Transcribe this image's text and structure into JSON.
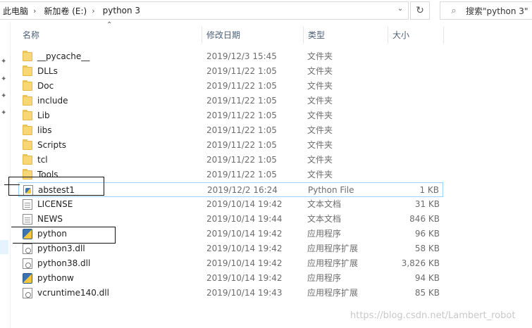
{
  "address": {
    "crumbs": [
      "此电脑",
      "新加卷 (E:)",
      "python 3"
    ],
    "separator": "›",
    "dropdown_glyph": "⌄",
    "refresh_glyph": "↻"
  },
  "search": {
    "placeholder": "搜索\"python 3\"",
    "icon_glyph": "⌕"
  },
  "columns": {
    "name": "名称",
    "date": "修改日期",
    "type": "类型",
    "size": "大小",
    "sort_glyph": "⌃"
  },
  "left_pane": {
    "pin_glyph": "✦"
  },
  "files": [
    {
      "name": "__pycache__",
      "date": "2019/12/3 15:45",
      "type": "文件夹",
      "size": "",
      "icon": "folder-icon"
    },
    {
      "name": "DLLs",
      "date": "2019/11/22 1:05",
      "type": "文件夹",
      "size": "",
      "icon": "folder-icon"
    },
    {
      "name": "Doc",
      "date": "2019/11/22 1:05",
      "type": "文件夹",
      "size": "",
      "icon": "folder-icon"
    },
    {
      "name": "include",
      "date": "2019/11/22 1:05",
      "type": "文件夹",
      "size": "",
      "icon": "folder-icon"
    },
    {
      "name": "Lib",
      "date": "2019/11/22 1:05",
      "type": "文件夹",
      "size": "",
      "icon": "folder-icon"
    },
    {
      "name": "libs",
      "date": "2019/11/22 1:05",
      "type": "文件夹",
      "size": "",
      "icon": "folder-icon"
    },
    {
      "name": "Scripts",
      "date": "2019/11/22 1:05",
      "type": "文件夹",
      "size": "",
      "icon": "folder-icon"
    },
    {
      "name": "tcl",
      "date": "2019/11/22 1:05",
      "type": "文件夹",
      "size": "",
      "icon": "folder-icon"
    },
    {
      "name": "Tools",
      "date": "2019/11/22 1:05",
      "type": "文件夹",
      "size": "",
      "icon": "folder-icon"
    },
    {
      "name": "abstest1",
      "date": "2019/12/2 16:24",
      "type": "Python File",
      "size": "1 KB",
      "icon": "python-file-icon"
    },
    {
      "name": "LICENSE",
      "date": "2019/10/14 19:42",
      "type": "文本文档",
      "size": "31 KB",
      "icon": "text-document-icon"
    },
    {
      "name": "NEWS",
      "date": "2019/10/14 19:44",
      "type": "文本文档",
      "size": "846 KB",
      "icon": "text-document-icon"
    },
    {
      "name": "python",
      "date": "2019/10/14 19:42",
      "type": "应用程序",
      "size": "96 KB",
      "icon": "python-app-icon"
    },
    {
      "name": "python3.dll",
      "date": "2019/10/14 19:42",
      "type": "应用程序扩展",
      "size": "58 KB",
      "icon": "dll-icon"
    },
    {
      "name": "python38.dll",
      "date": "2019/10/14 19:42",
      "type": "应用程序扩展",
      "size": "3,826 KB",
      "icon": "dll-icon"
    },
    {
      "name": "pythonw",
      "date": "2019/10/14 19:42",
      "type": "应用程序",
      "size": "94 KB",
      "icon": "python-app-icon"
    },
    {
      "name": "vcruntime140.dll",
      "date": "2019/10/14 19:43",
      "type": "应用程序扩展",
      "size": "85 KB",
      "icon": "dll-icon"
    }
  ],
  "watermark": "https://blog.csdn.net/Lambert_robot",
  "colors": {
    "header_text": "#4c607a",
    "hover_border": "#99d1ff",
    "folder": "#f7d774"
  }
}
